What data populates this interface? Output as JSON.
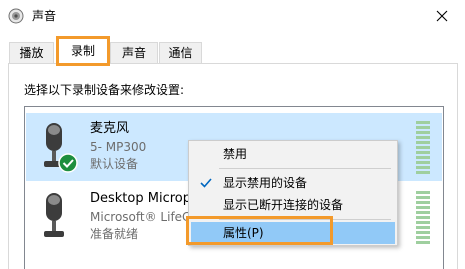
{
  "window": {
    "title": "声音",
    "close_glyph": "✕"
  },
  "tabs": [
    {
      "label": "播放",
      "active": false
    },
    {
      "label": "录制",
      "active": true
    },
    {
      "label": "声音",
      "active": false
    },
    {
      "label": "通信",
      "active": false
    }
  ],
  "instruction": "选择以下录制设备来修改设置:",
  "devices": [
    {
      "name": "麦克风",
      "line2": "5- MP300",
      "line3": "默认设备",
      "selected": true,
      "default_badge_icon": "green-check-icon"
    },
    {
      "name": "Desktop Microphone",
      "line2": "Microsoft® LifeCam",
      "line3": "准备就绪",
      "selected": false
    }
  ],
  "context_menu": {
    "items": [
      {
        "label": "禁用",
        "checked": false
      },
      {
        "label": "显示禁用的设备",
        "checked": true
      },
      {
        "label": "显示已断开连接的设备",
        "checked": false
      },
      {
        "label": "属性(P)",
        "checked": false,
        "hover": true
      }
    ]
  },
  "colors": {
    "accent_highlight": "#f39a2b",
    "selected_row": "#cce8ff",
    "menu_hover": "#91c9f7",
    "level_meter": "#9fcf9f",
    "check_blue": "#0067c0"
  }
}
